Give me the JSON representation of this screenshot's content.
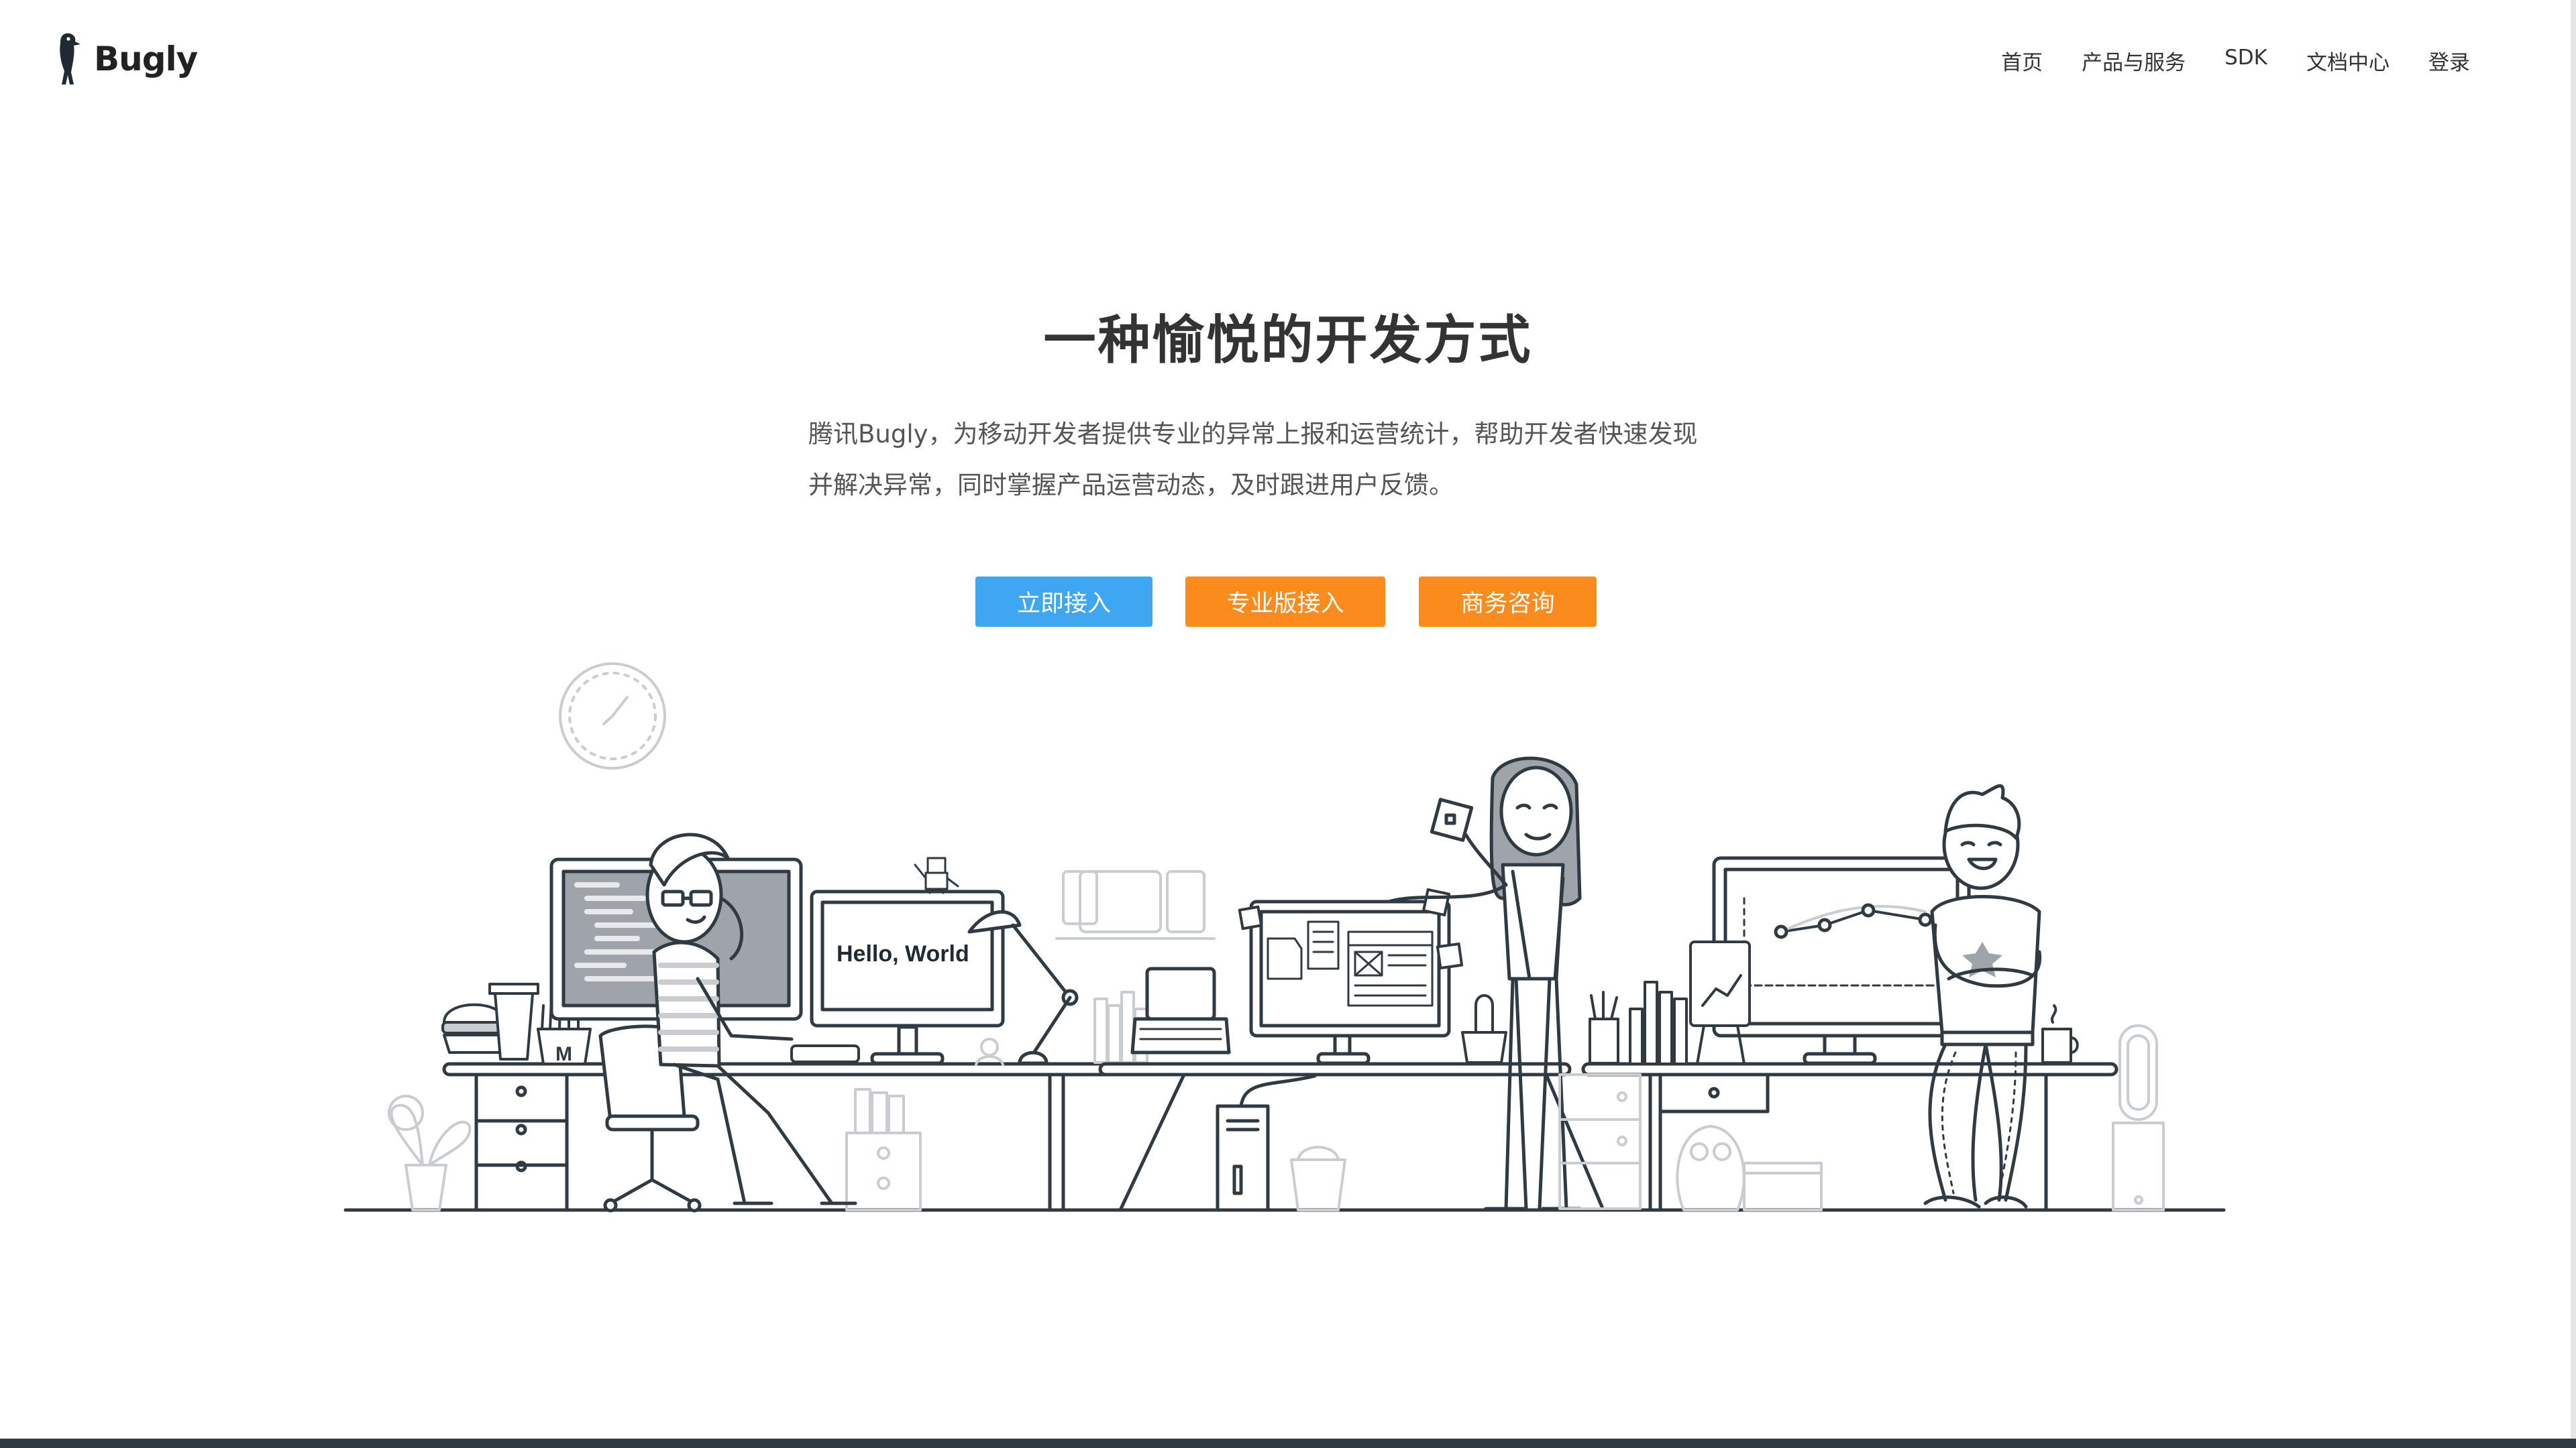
{
  "brand": {
    "name": "Bugly",
    "icon": "woodpecker-icon"
  },
  "nav": {
    "items": [
      {
        "label": "首页"
      },
      {
        "label": "产品与服务"
      },
      {
        "label": "SDK"
      },
      {
        "label": "文档中心"
      },
      {
        "label": "登录"
      }
    ]
  },
  "hero": {
    "title": "一种愉悦的开发方式",
    "desc_line1": "腾讯Bugly，为移动开发者提供专业的异常上报和运营统计，帮助开发者快速发现",
    "desc_line2": "并解决异常，同时掌握产品运营动态，及时跟进用户反馈。"
  },
  "buttons": {
    "primary": "立即接入",
    "pro": "专业版接入",
    "business": "商务咨询"
  },
  "illustration": {
    "monitor_text": "Hello, World",
    "bag_letter": "M"
  },
  "colors": {
    "primary_blue": "#3fa7f1",
    "accent_orange": "#fb8b1c",
    "line_dark": "#2f3a43",
    "line_light": "#c9cdd1"
  }
}
